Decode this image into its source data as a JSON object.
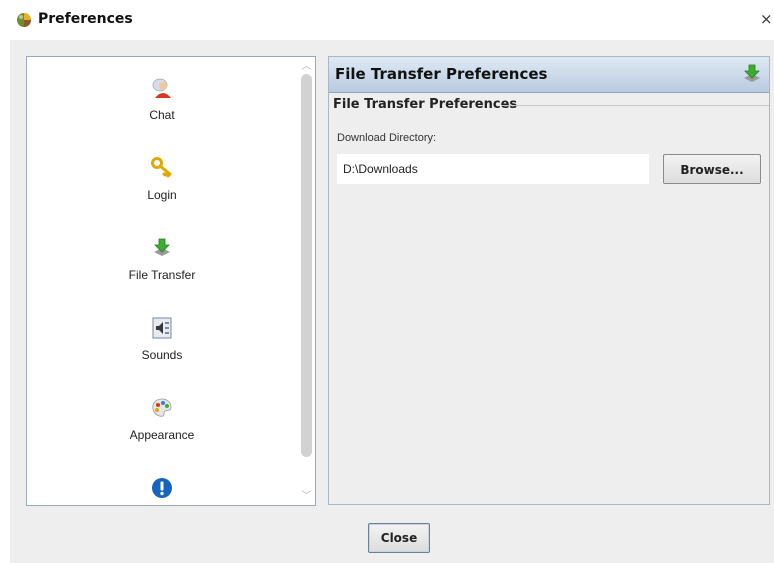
{
  "window": {
    "title": "Preferences",
    "close_glyph": "×"
  },
  "sidebar": {
    "items": [
      {
        "label": "Chat",
        "icon": "chat-user-icon"
      },
      {
        "label": "Login",
        "icon": "key-icon"
      },
      {
        "label": "File Transfer",
        "icon": "download-arrow-icon"
      },
      {
        "label": "Sounds",
        "icon": "speaker-icon"
      },
      {
        "label": "Appearance",
        "icon": "palette-icon"
      },
      {
        "label": "",
        "icon": "alert-icon"
      }
    ]
  },
  "panel": {
    "header_title": "File Transfer Preferences",
    "group_title": "File Transfer Preferences",
    "download_label": "Download Directory:",
    "download_dir": "D:\\Downloads",
    "browse_label": "Browse..."
  },
  "footer": {
    "close_label": "Close"
  },
  "colors": {
    "header_gradient_top": "#dfe9f4",
    "header_gradient_bottom": "#b9cbe0",
    "dialog_background": "#eeeeee",
    "alert_blue": "#1565c0"
  }
}
